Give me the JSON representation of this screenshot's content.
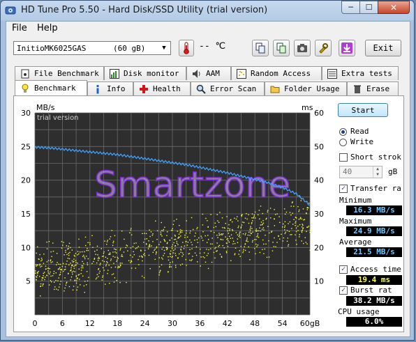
{
  "window": {
    "title": "HD Tune Pro 5.50 - Hard Disk/SSD Utility (trial version)",
    "minimize": "─",
    "maximize": "☐",
    "close": "✕"
  },
  "menu": {
    "file": "File",
    "help": "Help"
  },
  "toolbar": {
    "drive": "InitioMK6025GAS",
    "drive_size": "(60 gB)",
    "temperature": "-- ",
    "temperature_unit": "℃",
    "exit_label": "Exit"
  },
  "tabs_top": [
    {
      "label": "File Benchmark",
      "icon": "file-benchmark-icon"
    },
    {
      "label": "Disk monitor",
      "icon": "disk-monitor-icon"
    },
    {
      "label": "AAM",
      "icon": "speaker-icon"
    },
    {
      "label": "Random Access",
      "icon": "random-access-icon"
    },
    {
      "label": "Extra tests",
      "icon": "extra-tests-icon"
    }
  ],
  "tabs_bottom": [
    {
      "label": "Benchmark",
      "icon": "lightbulb-icon",
      "active": true
    },
    {
      "label": "Info",
      "icon": "info-icon"
    },
    {
      "label": "Health",
      "icon": "health-cross-icon"
    },
    {
      "label": "Error Scan",
      "icon": "magnifier-icon"
    },
    {
      "label": "Folder Usage",
      "icon": "folder-icon"
    },
    {
      "label": "Erase",
      "icon": "trash-icon"
    }
  ],
  "benchmark": {
    "start_label": "Start",
    "read_label": "Read",
    "write_label": "Write",
    "read_selected": true,
    "short_stroke_label": "Short strok",
    "short_stroke_value": "40",
    "short_stroke_unit": "gB",
    "transfer_rate_label": "Transfer ra",
    "minimum_label": "Minimum",
    "minimum_value": "16.3 MB/s",
    "maximum_label": "Maximum",
    "maximum_value": "24.9 MB/s",
    "average_label": "Average",
    "average_value": "21.5 MB/s",
    "access_time_label": "Access time",
    "access_time_value": "19.4 ms",
    "burst_rate_label": "Burst rat",
    "burst_rate_value": "38.2 MB/s",
    "cpu_usage_label": "CPU usage",
    "cpu_usage_value": "6.0%"
  },
  "chart_data": {
    "type": "line",
    "left_axis_label": "MB/s",
    "right_axis_label": "ms",
    "trial_text": "trial version",
    "watermark": "Smartzone",
    "x_ticks": [
      "0",
      "6",
      "12",
      "18",
      "24",
      "30",
      "36",
      "42",
      "48",
      "54",
      "60gB"
    ],
    "y_left_ticks": [
      "5",
      "10",
      "15",
      "20",
      "25",
      "30"
    ],
    "y_right_ticks": [
      "10",
      "20",
      "30",
      "40",
      "50",
      "60"
    ],
    "xlim": [
      0,
      60
    ],
    "ylim_left": [
      0,
      30
    ],
    "ylim_right": [
      0,
      60
    ],
    "transfer_series": {
      "name": "Transfer rate",
      "color": "#3fa0ff",
      "x": [
        0,
        3,
        6,
        9,
        12,
        15,
        18,
        21,
        24,
        27,
        30,
        33,
        36,
        39,
        42,
        45,
        48,
        51,
        54,
        57,
        60
      ],
      "y": [
        24.9,
        24.8,
        24.6,
        24.4,
        24.2,
        24.0,
        23.8,
        23.5,
        23.2,
        22.9,
        22.6,
        22.3,
        21.9,
        21.5,
        21.1,
        20.6,
        20.1,
        19.6,
        18.9,
        18.0,
        16.3
      ]
    },
    "access_series": {
      "name": "Access time",
      "color": "#ffff40",
      "trend_start_ms": 13,
      "trend_end_ms": 28,
      "spread_ms": 9
    }
  }
}
